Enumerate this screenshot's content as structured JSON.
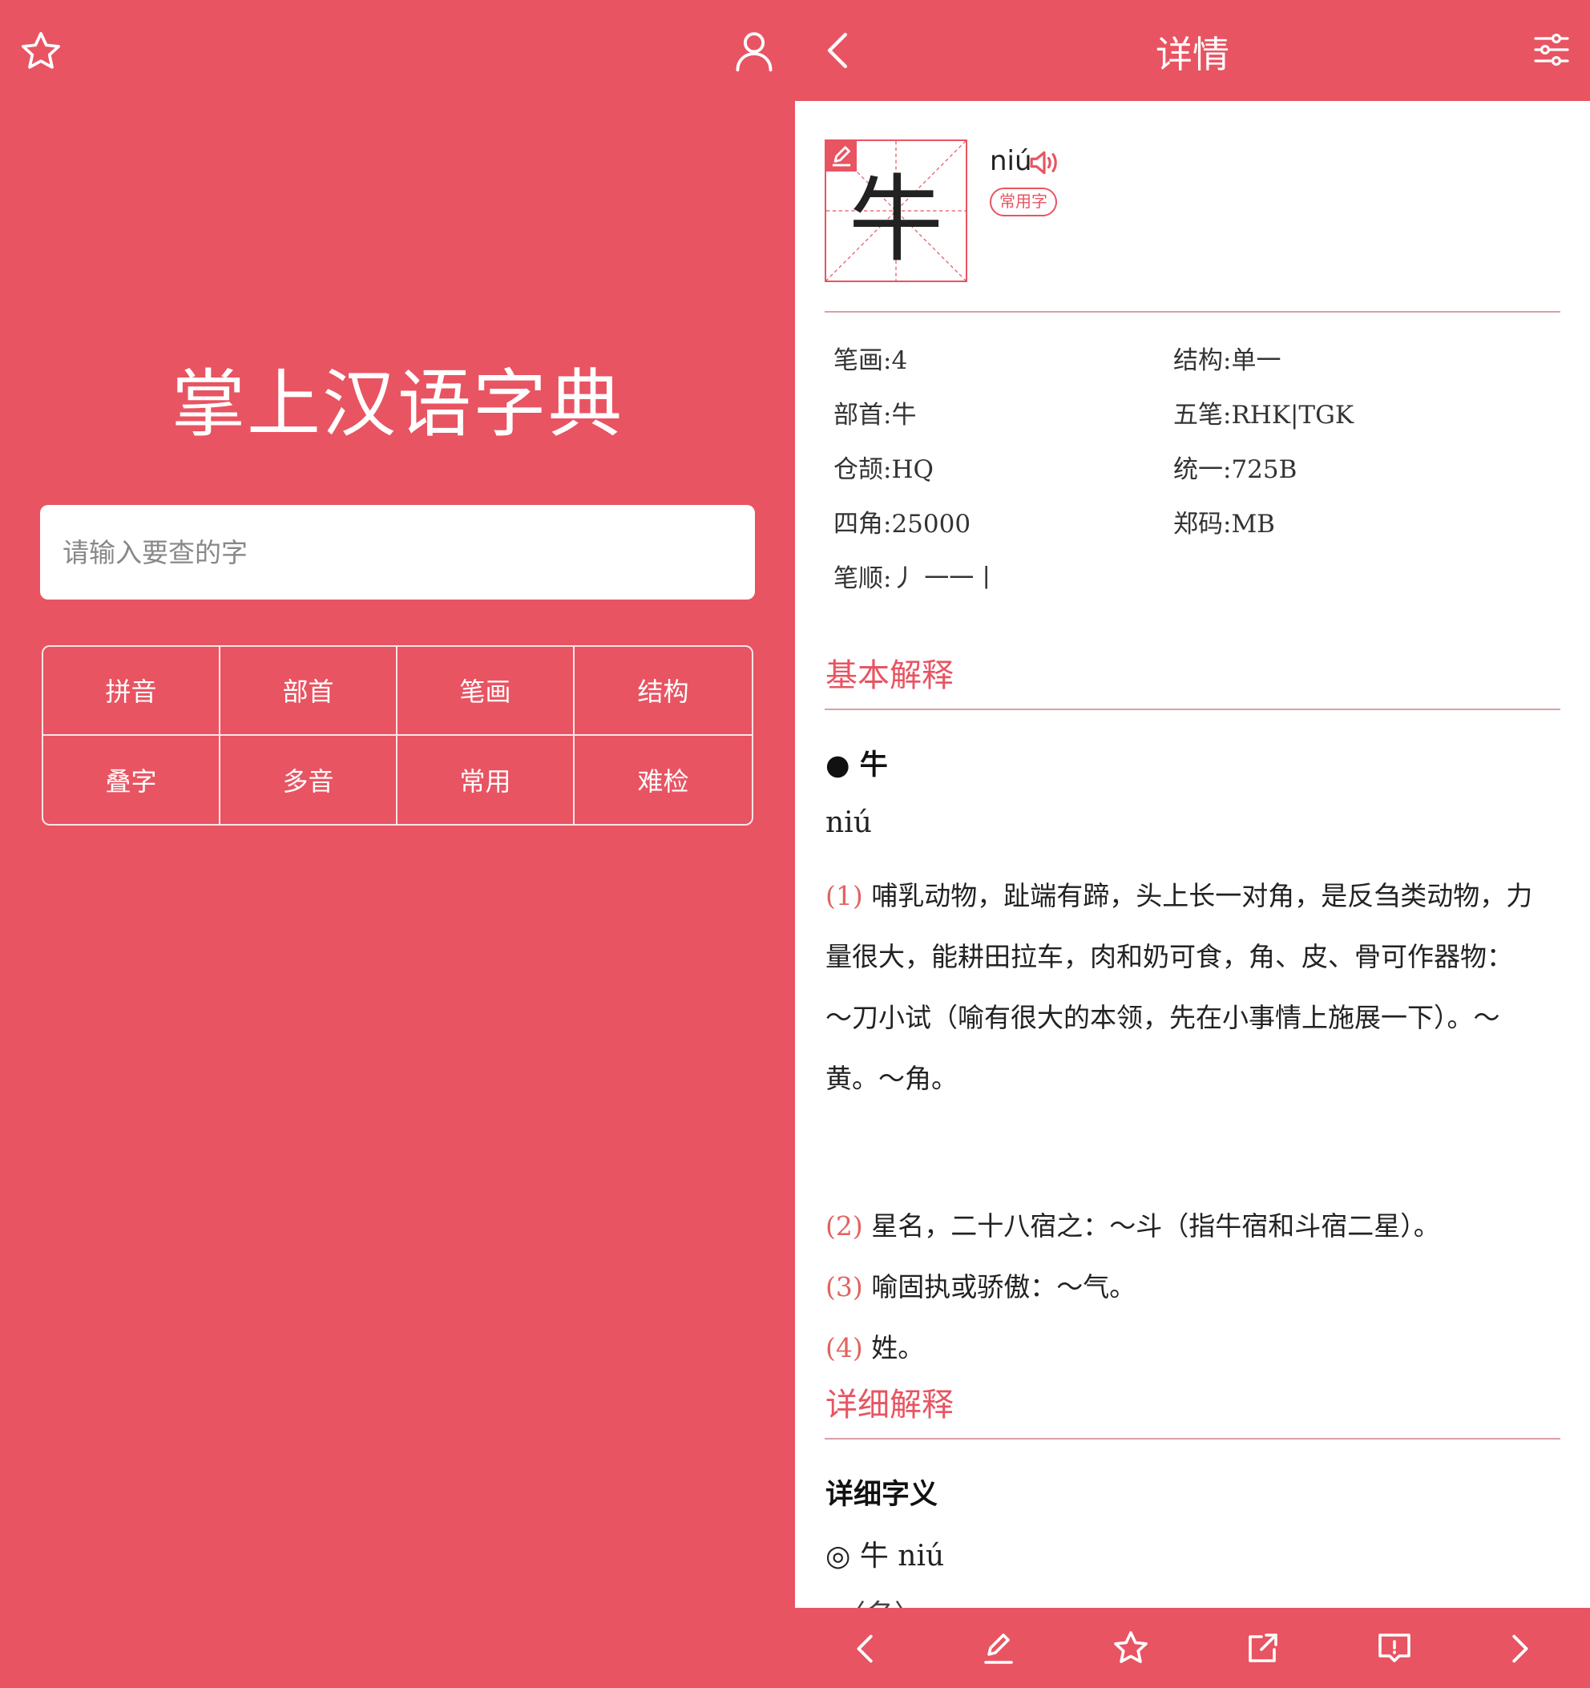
{
  "left": {
    "app_title": "掌上汉语字典",
    "search": {
      "placeholder": "请输入要查的字"
    },
    "categories": [
      "拼音",
      "部首",
      "笔画",
      "结构",
      "叠字",
      "多音",
      "常用",
      "难检"
    ],
    "icons": {
      "favorite": "star-icon",
      "profile": "user-icon"
    }
  },
  "right": {
    "header": {
      "title": "详情",
      "icons": {
        "back": "chevron-left-icon",
        "settings": "sliders-icon"
      }
    },
    "char": {
      "glyph": "牛",
      "pinyin": "niú",
      "tag": "常用字"
    },
    "info": {
      "strokes": "笔画:4",
      "structure": "结构:单一",
      "radical": "部首:牛",
      "wubi": "五笔:RHK|TGK",
      "cangjie": "仓颉:HQ",
      "unicode": "统一:725B",
      "sijiao": "四角:25000",
      "zhengma": "郑码:MB",
      "stroke_order": "笔顺:丿 一一丨"
    },
    "basic": {
      "title": "基本解释",
      "headword": "● 牛",
      "pinyin": "niú",
      "defs": [
        {
          "num": "(1)",
          "text": " 哺乳动物，趾端有蹄，头上长一对角，是反刍类动物，力量很大，能耕田拉车，肉和奶可食，角、皮、骨可作器物：～刀小试（喻有很大的本领，先在小事情上施展一下）。～黄。～角。"
        },
        {
          "num": "(2)",
          "text": " 星名，二十八宿之：～斗（指牛宿和斗宿二星）。"
        },
        {
          "num": "(3)",
          "text": " 喻固执或骄傲：～气。"
        },
        {
          "num": "(4)",
          "text": " 姓。"
        }
      ]
    },
    "detail": {
      "title": "详细解释",
      "subtitle": "详细字义",
      "entry": "◎ 牛 niú",
      "next": "〈名〉"
    },
    "colors": {
      "accent": "#E85462",
      "number": "#E0645F"
    },
    "bottom_icons": [
      "chevron-left-icon",
      "pencil-icon",
      "star-icon",
      "share-icon",
      "report-icon",
      "chevron-right-icon"
    ]
  }
}
